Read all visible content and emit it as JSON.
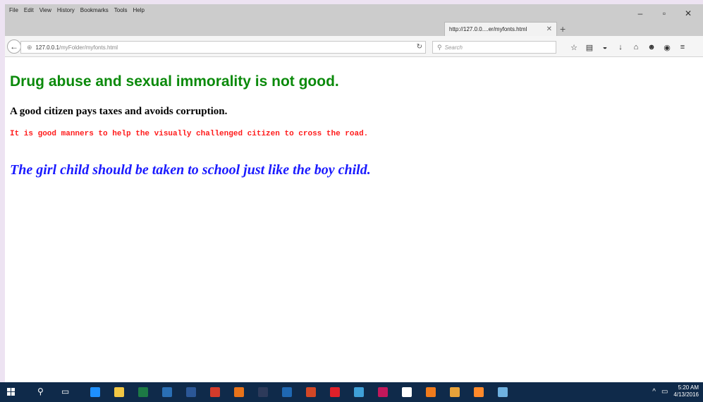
{
  "menu": [
    "File",
    "Edit",
    "View",
    "History",
    "Bookmarks",
    "Tools",
    "Help"
  ],
  "window_controls": {
    "minimize": "–",
    "maximize": "▫",
    "close": "✕"
  },
  "tab": {
    "title": "http://127.0.0....er/myfonts.html",
    "close": "✕",
    "new": "+"
  },
  "url": {
    "host": "127.0.0.1",
    "path": "/myFolder/myfonts.html"
  },
  "search": {
    "placeholder": "Search"
  },
  "content": {
    "heading": "Drug abuse and sexual immorality is not good.",
    "subheading": "A good citizen pays taxes and avoids corruption.",
    "mono_line": "It is good manners to help the visually challenged citizen to cross the road.",
    "italic_line": "The girl child should be taken to school just like the boy child."
  },
  "taskbar": {
    "time": "5:20 AM",
    "date": "4/13/2016",
    "apps": [
      {
        "name": "edge-icon",
        "color": "#1e90ff"
      },
      {
        "name": "file-explorer-icon",
        "color": "#f2c744"
      },
      {
        "name": "excel-icon",
        "color": "#1d7a45"
      },
      {
        "name": "outlook-icon",
        "color": "#2a6fb5"
      },
      {
        "name": "word-icon",
        "color": "#2b5797"
      },
      {
        "name": "acrobat-icon",
        "color": "#d43b2b"
      },
      {
        "name": "media-player-icon",
        "color": "#e8731a"
      },
      {
        "name": "photoshop-icon",
        "color": "#2d3a5a"
      },
      {
        "name": "photoshop2-icon",
        "color": "#1f68b3"
      },
      {
        "name": "powerpoint-icon",
        "color": "#d24726"
      },
      {
        "name": "opera-icon",
        "color": "#e0202a"
      },
      {
        "name": "app-snowflake-icon",
        "color": "#3fa0d8"
      },
      {
        "name": "indesign-icon",
        "color": "#c2185b"
      },
      {
        "name": "store-icon",
        "color": "#ffffff"
      },
      {
        "name": "orange-app-icon",
        "color": "#f07b1c"
      },
      {
        "name": "tiger-app-icon",
        "color": "#e8a33a"
      },
      {
        "name": "firefox-icon",
        "color": "#ff8a2b"
      },
      {
        "name": "notes-app-icon",
        "color": "#6fb1e0"
      }
    ]
  }
}
